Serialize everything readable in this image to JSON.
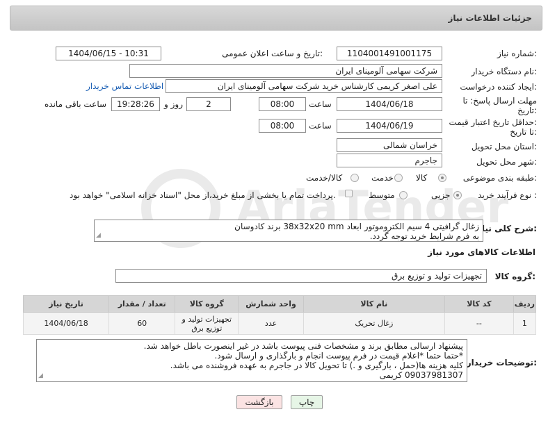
{
  "header": {
    "title": "جزئیات اطلاعات نیاز"
  },
  "form": {
    "need_number_label": "شماره نیاز:",
    "need_number": "1104001491001175",
    "announce_label": "تاریخ و ساعت اعلان عمومی:",
    "announce_value": "1404/06/15 - 10:31",
    "buyer_org_label": "نام دستگاه خریدار:",
    "buyer_org": "شرکت سهامی آلومینای ایران",
    "requester_label": "ایجاد کننده درخواست:",
    "requester": "علی اصغر کریمی کارشناس خرید شرکت سهامی آلومینای ایران",
    "contact_link": "اطلاعات تماس خریدار",
    "deadline_label_1": "مهلت ارسال پاسخ: تا",
    "deadline_label_2": "تاریخ:",
    "deadline_date": "1404/06/18",
    "time_label": "ساعت",
    "deadline_time": "08:00",
    "days_value": "2",
    "days_label": "روز و",
    "remaining_time": "19:28:26",
    "remaining_label": "ساعت باقی مانده",
    "validity_label_1": "حداقل تاریخ اعتبار قیمت:",
    "validity_label_2": "تا تاریخ:",
    "validity_date": "1404/06/19",
    "validity_time": "08:00",
    "province_label": "استان محل تحویل:",
    "province": "خراسان شمالی",
    "city_label": "شهر محل تحویل:",
    "city": "جاجرم",
    "category_label": "طبقه بندی موضوعی:",
    "category_options": [
      "کالا",
      "خدمت",
      "کالا/خدمت"
    ],
    "category_selected": 0,
    "process_label": "نوع فرآیند خرید :",
    "process_options": [
      "جزیی",
      "متوسط"
    ],
    "process_selected": 0,
    "payment_note": "پرداخت تمام یا بخشی از مبلغ خرید،از محل \"اسناد خزانه اسلامی\" خواهد بود."
  },
  "description": {
    "label": "شرح کلی نیاز:",
    "lines": [
      "زغال گرافیتی 4 سیم الکتروموتور ابعاد 38x32x20 mm  برند کادوسان",
      "به فرم شرایط خرید توجه گردد."
    ]
  },
  "goods": {
    "section_title": "اطلاعات کالاهای مورد نیاز",
    "group_label": "گروه کالا:",
    "group_value": "تجهیزات تولید و توزیع برق",
    "columns": [
      "ردیف",
      "کد کالا",
      "نام کالا",
      "واحد شمارش",
      "گروه کالا",
      "تعداد / مقدار",
      "تاریخ نیاز"
    ],
    "rows": [
      [
        "1",
        "--",
        "زغال تحریک",
        "عدد",
        "تجهیزات تولید و توزیع برق",
        "60",
        "1404/06/18"
      ]
    ]
  },
  "buyer_notes": {
    "label": "توضیحات خریدار:",
    "lines": [
      "پیشنهاد ارسالی مطابق برند و مشخصات فنی پیوست باشد در غیر اینصورت باطل خواهد شد.",
      "*حتما حتما *اعلام قیمت در فرم پیوست انجام و بارگذاری و ارسال شود.",
      "کلیه هزینه ها(حمل ، بارگیری و .) تا تحویل کالا در جاجرم به عهده فروشنده می باشد.",
      "09037981307 کریمی"
    ]
  },
  "buttons": {
    "print": "چاپ",
    "back": "بازگشت"
  },
  "colors": {
    "link": "#1a5fb4",
    "print_bg": "#e6f5e6",
    "back_bg": "#fbe3e3"
  }
}
